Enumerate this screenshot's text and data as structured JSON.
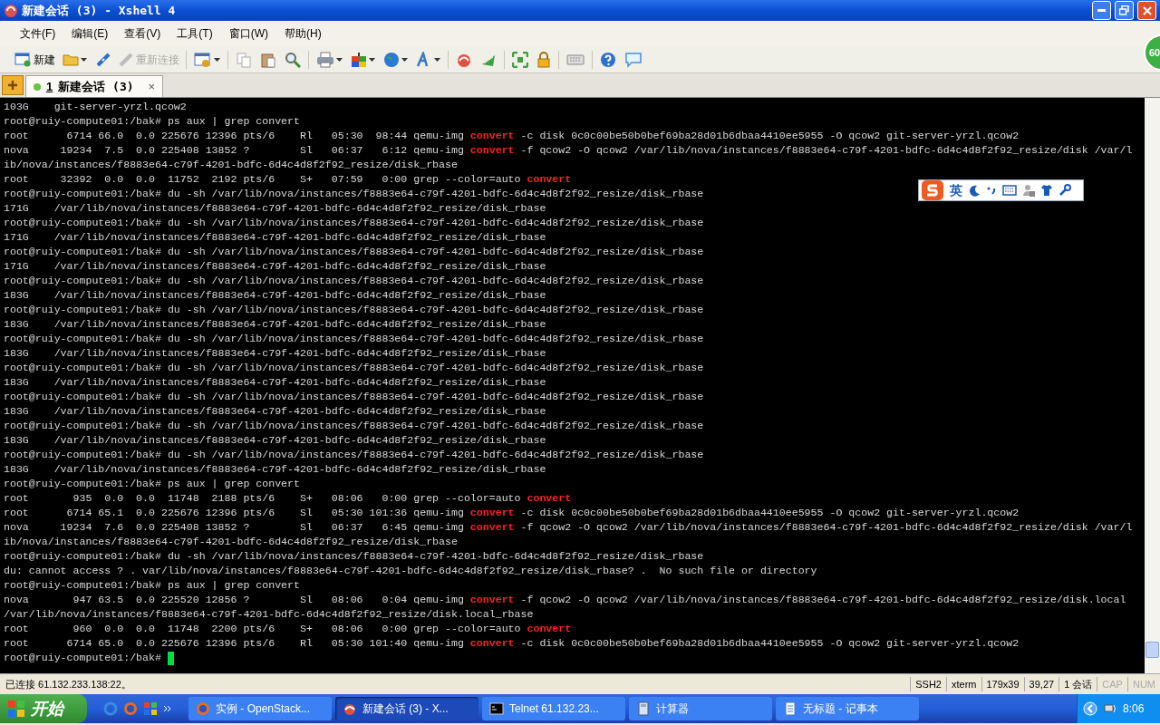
{
  "window": {
    "title": "新建会话 (3) - Xshell 4"
  },
  "menu": [
    "文件(F)",
    "编辑(E)",
    "查看(V)",
    "工具(T)",
    "窗口(W)",
    "帮助(H)"
  ],
  "toolbar": {
    "new_label": "新建",
    "reconnect": {
      "label": "重新连接",
      "disabled": true
    }
  },
  "corner_badge": {
    "text": "60"
  },
  "tabs": [
    {
      "number": "1",
      "label": "新建会话 (3)",
      "close": "×",
      "connected": true,
      "selected": true
    }
  ],
  "terminal": {
    "cursor": true,
    "lines": [
      {
        "text": "103G    git-server-yrzl.qcow2"
      },
      {
        "text": "root@ruiy-compute01:/bak# ps aux | grep convert"
      },
      {
        "segments": [
          {
            "text": "root      6714 66.0  0.0 225676 12396 pts/6    Rl   05:30  98:44 qemu-img ",
            "kind": "plain"
          },
          {
            "text": "convert",
            "kind": "match"
          },
          {
            "text": " -c disk 0c0c00be50b0bef69ba28d01b6dbaa4410ee5955 -O qcow2 git-server-yrzl.qcow2",
            "kind": "plain"
          }
        ]
      },
      {
        "segments": [
          {
            "text": "nova     19234  7.5  0.0 225408 13852 ?        Sl   06:37   6:12 qemu-img ",
            "kind": "plain"
          },
          {
            "text": "convert",
            "kind": "match"
          },
          {
            "text": " -f qcow2 -O qcow2 /var/lib/nova/instances/f8883e64-c79f-4201-bdfc-6d4c4d8f2f92_resize/disk /var/l",
            "kind": "plain"
          }
        ]
      },
      {
        "text": "ib/nova/instances/f8883e64-c79f-4201-bdfc-6d4c4d8f2f92_resize/disk_rbase"
      },
      {
        "segments": [
          {
            "text": "root     32392  0.0  0.0  11752  2192 pts/6    S+   07:59   0:00 grep --color=auto ",
            "kind": "plain"
          },
          {
            "text": "convert",
            "kind": "match"
          }
        ]
      },
      {
        "text": "root@ruiy-compute01:/bak# du -sh /var/lib/nova/instances/f8883e64-c79f-4201-bdfc-6d4c4d8f2f92_resize/disk_rbase"
      },
      {
        "text": "171G    /var/lib/nova/instances/f8883e64-c79f-4201-bdfc-6d4c4d8f2f92_resize/disk_rbase"
      },
      {
        "text": "root@ruiy-compute01:/bak# du -sh /var/lib/nova/instances/f8883e64-c79f-4201-bdfc-6d4c4d8f2f92_resize/disk_rbase"
      },
      {
        "text": "171G    /var/lib/nova/instances/f8883e64-c79f-4201-bdfc-6d4c4d8f2f92_resize/disk_rbase"
      },
      {
        "text": "root@ruiy-compute01:/bak# du -sh /var/lib/nova/instances/f8883e64-c79f-4201-bdfc-6d4c4d8f2f92_resize/disk_rbase"
      },
      {
        "text": "171G    /var/lib/nova/instances/f8883e64-c79f-4201-bdfc-6d4c4d8f2f92_resize/disk_rbase"
      },
      {
        "text": "root@ruiy-compute01:/bak# du -sh /var/lib/nova/instances/f8883e64-c79f-4201-bdfc-6d4c4d8f2f92_resize/disk_rbase"
      },
      {
        "text": "183G    /var/lib/nova/instances/f8883e64-c79f-4201-bdfc-6d4c4d8f2f92_resize/disk_rbase"
      },
      {
        "text": "root@ruiy-compute01:/bak# du -sh /var/lib/nova/instances/f8883e64-c79f-4201-bdfc-6d4c4d8f2f92_resize/disk_rbase"
      },
      {
        "text": "183G    /var/lib/nova/instances/f8883e64-c79f-4201-bdfc-6d4c4d8f2f92_resize/disk_rbase"
      },
      {
        "text": "root@ruiy-compute01:/bak# du -sh /var/lib/nova/instances/f8883e64-c79f-4201-bdfc-6d4c4d8f2f92_resize/disk_rbase"
      },
      {
        "text": "183G    /var/lib/nova/instances/f8883e64-c79f-4201-bdfc-6d4c4d8f2f92_resize/disk_rbase"
      },
      {
        "text": "root@ruiy-compute01:/bak# du -sh /var/lib/nova/instances/f8883e64-c79f-4201-bdfc-6d4c4d8f2f92_resize/disk_rbase"
      },
      {
        "text": "183G    /var/lib/nova/instances/f8883e64-c79f-4201-bdfc-6d4c4d8f2f92_resize/disk_rbase"
      },
      {
        "text": "root@ruiy-compute01:/bak# du -sh /var/lib/nova/instances/f8883e64-c79f-4201-bdfc-6d4c4d8f2f92_resize/disk_rbase"
      },
      {
        "text": "183G    /var/lib/nova/instances/f8883e64-c79f-4201-bdfc-6d4c4d8f2f92_resize/disk_rbase"
      },
      {
        "text": "root@ruiy-compute01:/bak# du -sh /var/lib/nova/instances/f8883e64-c79f-4201-bdfc-6d4c4d8f2f92_resize/disk_rbase"
      },
      {
        "text": "183G    /var/lib/nova/instances/f8883e64-c79f-4201-bdfc-6d4c4d8f2f92_resize/disk_rbase"
      },
      {
        "text": "root@ruiy-compute01:/bak# du -sh /var/lib/nova/instances/f8883e64-c79f-4201-bdfc-6d4c4d8f2f92_resize/disk_rbase"
      },
      {
        "text": "183G    /var/lib/nova/instances/f8883e64-c79f-4201-bdfc-6d4c4d8f2f92_resize/disk_rbase"
      },
      {
        "text": "root@ruiy-compute01:/bak# ps aux | grep convert"
      },
      {
        "segments": [
          {
            "text": "root       935  0.0  0.0  11748  2188 pts/6    S+   08:06   0:00 grep --color=auto ",
            "kind": "plain"
          },
          {
            "text": "convert",
            "kind": "match"
          }
        ]
      },
      {
        "segments": [
          {
            "text": "root      6714 65.1  0.0 225676 12396 pts/6    Sl   05:30 101:36 qemu-img ",
            "kind": "plain"
          },
          {
            "text": "convert",
            "kind": "match"
          },
          {
            "text": " -c disk 0c0c00be50b0bef69ba28d01b6dbaa4410ee5955 -O qcow2 git-server-yrzl.qcow2",
            "kind": "plain"
          }
        ]
      },
      {
        "segments": [
          {
            "text": "nova     19234  7.6  0.0 225408 13852 ?        Sl   06:37   6:45 qemu-img ",
            "kind": "plain"
          },
          {
            "text": "convert",
            "kind": "match"
          },
          {
            "text": " -f qcow2 -O qcow2 /var/lib/nova/instances/f8883e64-c79f-4201-bdfc-6d4c4d8f2f92_resize/disk /var/l",
            "kind": "plain"
          }
        ]
      },
      {
        "text": "ib/nova/instances/f8883e64-c79f-4201-bdfc-6d4c4d8f2f92_resize/disk_rbase"
      },
      {
        "text": "root@ruiy-compute01:/bak# du -sh /var/lib/nova/instances/f8883e64-c79f-4201-bdfc-6d4c4d8f2f92_resize/disk_rbase"
      },
      {
        "text": "du: cannot access ? . var/lib/nova/instances/f8883e64-c79f-4201-bdfc-6d4c4d8f2f92_resize/disk_rbase? .  No such file or directory"
      },
      {
        "text": "root@ruiy-compute01:/bak# ps aux | grep convert"
      },
      {
        "segments": [
          {
            "text": "nova       947 63.5  0.0 225520 12856 ?        Sl   08:06   0:04 qemu-img ",
            "kind": "plain"
          },
          {
            "text": "convert",
            "kind": "match"
          },
          {
            "text": " -f qcow2 -O qcow2 /var/lib/nova/instances/f8883e64-c79f-4201-bdfc-6d4c4d8f2f92_resize/disk.local",
            "kind": "plain"
          }
        ]
      },
      {
        "text": "/var/lib/nova/instances/f8883e64-c79f-4201-bdfc-6d4c4d8f2f92_resize/disk.local_rbase"
      },
      {
        "segments": [
          {
            "text": "root       960  0.0  0.0  11748  2200 pts/6    S+   08:06   0:00 grep --color=auto ",
            "kind": "plain"
          },
          {
            "text": "convert",
            "kind": "match"
          }
        ]
      },
      {
        "segments": [
          {
            "text": "root      6714 65.0  0.0 225676 12396 pts/6    Rl   05:30 101:40 qemu-img ",
            "kind": "plain"
          },
          {
            "text": "convert",
            "kind": "match"
          },
          {
            "text": " -c disk 0c0c00be50b0bef69ba28d01b6dbaa4410ee5955 -O qcow2 git-server-yrzl.qcow2",
            "kind": "plain"
          }
        ]
      },
      {
        "text": "root@ruiy-compute01:/bak# "
      }
    ]
  },
  "ime_bar": {
    "mode": "英"
  },
  "status_bar": {
    "message": "已连接 61.132.233.138:22。",
    "cells": [
      {
        "text": "SSH2",
        "disabled": false
      },
      {
        "text": "xterm",
        "disabled": false
      },
      {
        "text": "179x39",
        "disabled": false
      },
      {
        "text": "39,27",
        "disabled": false
      },
      {
        "text": "1 会话",
        "disabled": false
      },
      {
        "text": "CAP",
        "disabled": true
      },
      {
        "text": "NUM",
        "disabled": true
      }
    ]
  },
  "taskbar": {
    "start": "开始",
    "tasks": [
      {
        "label": "实例 - OpenStack...",
        "selected": false
      },
      {
        "label": "新建会话 (3) - X...",
        "selected": true
      },
      {
        "label": "Telnet 61.132.23...",
        "selected": false
      },
      {
        "label": "计算器",
        "selected": false
      },
      {
        "label": "无标题 - 记事本",
        "selected": false
      }
    ],
    "clock": "8:06"
  }
}
